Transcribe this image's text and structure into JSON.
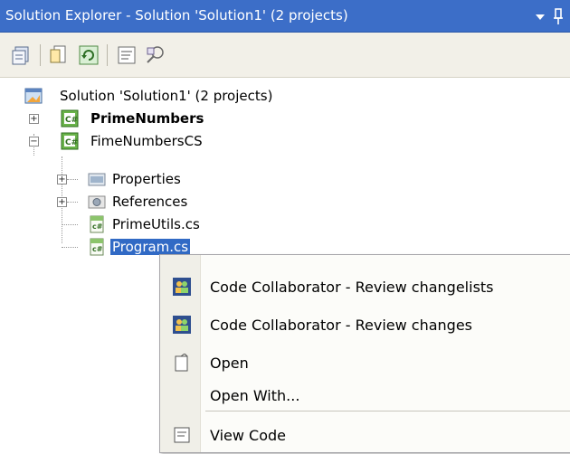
{
  "window": {
    "title": "Solution Explorer - Solution 'Solution1' (2 projects)",
    "dropdown_glyph": "▼",
    "pin_glyph": "⊥"
  },
  "toolbar": {
    "buttons": [
      {
        "icon": "solution-properties-icon"
      },
      {
        "icon": "show-all-files-icon"
      },
      {
        "icon": "refresh-icon"
      },
      {
        "icon": "view-code-icon"
      },
      {
        "icon": "class-view-icon"
      }
    ]
  },
  "tree": {
    "solution": "Solution 'Solution1' (2 projects)",
    "projects": [
      {
        "name": "PrimeNumbers",
        "bold": true,
        "expanded": false,
        "expander": "+"
      },
      {
        "name": "FimeNumbersCS",
        "expanded": true,
        "expander": "−",
        "children": [
          {
            "name": "Properties",
            "expander": "+"
          },
          {
            "name": "References",
            "expander": "+"
          },
          {
            "name": "PrimeUtils.cs"
          },
          {
            "name": "Program.cs",
            "selected": true
          }
        ]
      }
    ]
  },
  "context_menu": {
    "items": [
      {
        "label": "Code Collaborator - Review changelists",
        "icon": "code-collaborator-icon"
      },
      {
        "label": "Code Collaborator - Review changes",
        "icon": "code-collaborator-icon"
      },
      {
        "label": "Open",
        "icon": "open-file-icon"
      },
      {
        "label": "Open With...",
        "icon": ""
      },
      {
        "label": "View Code",
        "icon": "view-code-icon"
      }
    ]
  },
  "colors": {
    "titlebar": "#3c6ec8",
    "selection": "#316ac5",
    "toolbar": "#f2f0e8"
  }
}
